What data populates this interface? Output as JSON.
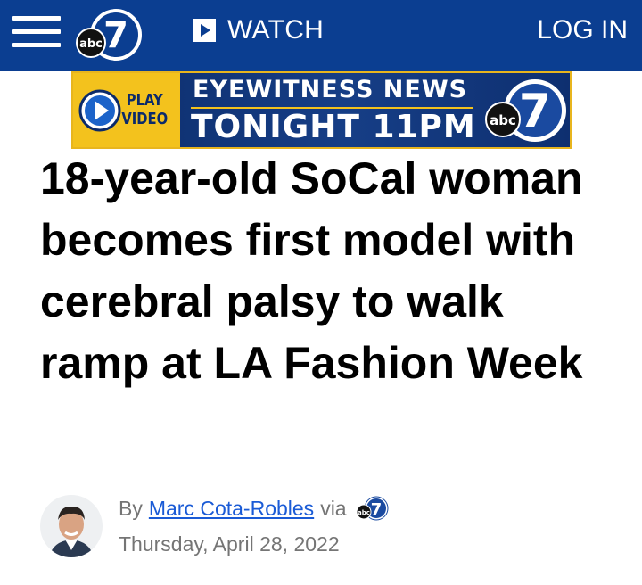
{
  "header": {
    "menu_icon": "hamburger-menu-icon",
    "logo_text": "abc",
    "logo_number": "7",
    "watch_icon": "play-square-icon",
    "watch_label": "WATCH",
    "login_label": "LOG IN",
    "bar_color": "#0b3e91"
  },
  "banner": {
    "play_line1": "PLAY",
    "play_line2": "VIDEO",
    "play_icon": "play-circle-icon",
    "line1": "EYEWITNESS NEWS",
    "line2": "TONIGHT 11PM",
    "logo_text": "abc",
    "logo_number": "7",
    "accent_color": "#f3c21d"
  },
  "article": {
    "headline": "18-year-old SoCal woman becomes first model with cerebral palsy to walk ramp at LA Fashion Week"
  },
  "byline": {
    "by": "By",
    "author": "Marc Cota-Robles",
    "via": "via",
    "via_logo_text": "abc",
    "via_logo_number": "7",
    "date": "Thursday, April 28, 2022",
    "link_color": "#1a5bd6"
  }
}
